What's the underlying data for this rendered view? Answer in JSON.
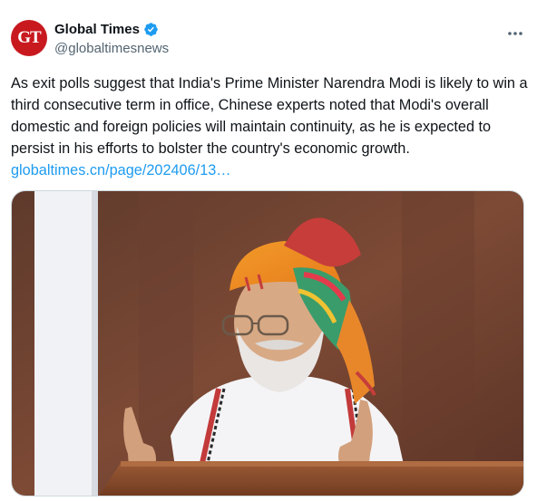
{
  "author": {
    "display_name": "Global Times",
    "handle": "@globaltimesnews",
    "avatar_initials": "GT",
    "avatar_color": "#c8191f",
    "verified_color": "#1d9bf0"
  },
  "tweet": {
    "text": "As exit polls suggest that India's Prime Minister Narendra Modi is likely to win a third consecutive term in office, Chinese experts noted that Modi's overall domestic and foreign policies will maintain continuity, as he is expected to persist in his efforts to bolster the country's economic growth. ",
    "link_text": "globaltimes.cn/page/202406/13…",
    "link_color": "#1d9bf0"
  },
  "icons": {
    "more": "more-horizontal-icon",
    "verified": "verified-badge-icon"
  }
}
